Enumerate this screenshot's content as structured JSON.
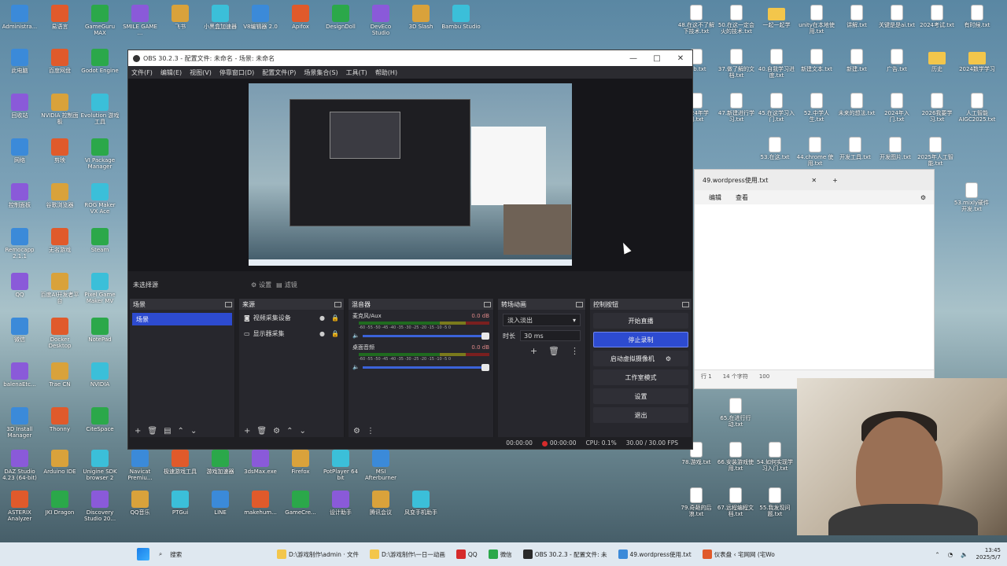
{
  "desktop": {
    "icons_left": [
      {
        "label": "Administra..."
      },
      {
        "label": "易语言"
      },
      {
        "label": "GameGuru MAX"
      },
      {
        "label": "SMILE GAME ..."
      },
      {
        "label": "飞书"
      },
      {
        "label": "小黑盒加速器"
      },
      {
        "label": "V8编辑器 2.0"
      },
      {
        "label": "Apifox"
      },
      {
        "label": "DesignDoll"
      },
      {
        "label": "DevEco Studio"
      },
      {
        "label": "3D Slash"
      },
      {
        "label": "Bambu Studio"
      },
      {
        "label": "此电脑"
      },
      {
        "label": "百度网盘"
      },
      {
        "label": "Godot Engine"
      },
      {
        "label": "回收站"
      },
      {
        "label": "NVIDIA 控制面板"
      },
      {
        "label": "Evolution 游戏工具"
      },
      {
        "label": "网络"
      },
      {
        "label": "剪映"
      },
      {
        "label": "VI Package Manager"
      },
      {
        "label": "控制面板"
      },
      {
        "label": "谷歌浏览器"
      },
      {
        "label": "ROG Maker VX Ace"
      },
      {
        "label": "Remocapp 2.1.1"
      },
      {
        "label": "无名游戏"
      },
      {
        "label": "Steam"
      },
      {
        "label": "QQ"
      },
      {
        "label": "百度AI开发者平台"
      },
      {
        "label": "Pixel Game Maker MV"
      },
      {
        "label": "微信"
      },
      {
        "label": "Docker Desktop"
      },
      {
        "label": "NotePad"
      },
      {
        "label": "balenaEtc..."
      },
      {
        "label": "Trae CN"
      },
      {
        "label": "NVIDIA"
      },
      {
        "label": "3D Install Manager"
      },
      {
        "label": "Thonny"
      },
      {
        "label": "CiteSpace"
      },
      {
        "label": "DAZ Studio 4.23 (64-bit)"
      },
      {
        "label": "Arduino IDE"
      },
      {
        "label": "Unigine SDK browser 2"
      },
      {
        "label": "Navicat Premiu..."
      },
      {
        "label": "极速游戏工具"
      },
      {
        "label": "游戏加速器"
      },
      {
        "label": "3dsMax.exe"
      },
      {
        "label": "Firefox"
      },
      {
        "label": "PotPlayer 64 bit"
      },
      {
        "label": "MSI Afterburner"
      },
      {
        "label": "ASTERIX Analyzer"
      },
      {
        "label": "JKI Dragon"
      },
      {
        "label": "Discovery Studio 20..."
      },
      {
        "label": "QQ音乐"
      },
      {
        "label": "PTGui"
      },
      {
        "label": "LINE"
      },
      {
        "label": "makehum..."
      },
      {
        "label": "GameCre..."
      },
      {
        "label": "设计助手"
      },
      {
        "label": "腾讯会议"
      },
      {
        "label": "风变手机助手"
      }
    ],
    "icons_right": [
      {
        "label": "48.在这不了解下技术.txt"
      },
      {
        "label": "50.在这一定会火的技术.txt"
      },
      {
        "label": "一起一起学"
      },
      {
        "label": "unity在本地使用.txt"
      },
      {
        "label": "讲解.txt"
      },
      {
        "label": "关键是是ai.txt"
      },
      {
        "label": "2024考试.txt"
      },
      {
        "label": "有时候.txt"
      },
      {
        "label": "28b.txt"
      },
      {
        "label": "37.做了解的文档.txt"
      },
      {
        "label": "40.自我学习进度.txt"
      },
      {
        "label": "新建文本.txt"
      },
      {
        "label": "新建.txt"
      },
      {
        "label": "广告.txt"
      },
      {
        "label": "历史"
      },
      {
        "label": "2024数学学习"
      },
      {
        "label": "2024年学习.txt"
      },
      {
        "label": "47.新建进行学习.txt"
      },
      {
        "label": "45.在这学习入门.txt"
      },
      {
        "label": "52.中学人生.txt"
      },
      {
        "label": "未来的想法.txt"
      },
      {
        "label": "2024年入门.txt"
      },
      {
        "label": "2026我要学习.txt"
      },
      {
        "label": "人工智能 AIGC2025.txt"
      },
      {
        "label": "53.在这.txt"
      },
      {
        "label": "44.chrome 使用.txt"
      },
      {
        "label": "开发工具.txt"
      },
      {
        "label": "开发图片.txt"
      },
      {
        "label": "2025年人工智能.txt"
      },
      {
        "label": "53.mixly硬件开发.txt"
      },
      {
        "label": "65.在进行行动.txt"
      },
      {
        "label": "78.游戏.txt"
      },
      {
        "label": "66.安装游戏使用.txt"
      },
      {
        "label": "54.如何实现学习入门.txt"
      },
      {
        "label": "79.奇葩的后浪.txt"
      },
      {
        "label": "67.远程编程文档.txt"
      },
      {
        "label": "55.我发现问题.txt"
      }
    ]
  },
  "obs": {
    "title": "OBS 30.2.3 - 配置文件: 未命名 - 场景: 未命名",
    "window_controls": [
      "—",
      "□",
      "✕"
    ],
    "menu": [
      "文件(F)",
      "编辑(E)",
      "视图(V)",
      "停靠窗口(D)",
      "配置文件(P)",
      "场景集合(S)",
      "工具(T)",
      "帮助(H)"
    ],
    "scenebar": {
      "no_source": "未选择源",
      "settings": "设置",
      "filters": "滤镜"
    },
    "docks": {
      "scenes": {
        "title": "场景",
        "items": [
          "场景"
        ]
      },
      "sources": {
        "title": "来源",
        "items": [
          "视频采集设备",
          "显示器采集"
        ]
      },
      "mixer": {
        "title": "混音器",
        "channels": [
          {
            "name": "麦克风/Aux",
            "db": "0.0 dB"
          },
          {
            "name": "桌面音频",
            "db": "0.0 dB"
          }
        ],
        "ticks": "-60 -55 -50 -45 -40 -35 -30 -25 -20 -15 -10 -5 0"
      },
      "transitions": {
        "title": "转场动画",
        "selected": "淡入淡出",
        "duration_label": "时长",
        "duration": "30 ms"
      },
      "controls": {
        "title": "控制按钮",
        "buttons": [
          "开始直播",
          "停止录制",
          "启动虚拟摄像机",
          "工作室模式",
          "设置",
          "退出"
        ]
      }
    },
    "status": {
      "stream_time": "00:00:00",
      "rec_time": "00:00:00",
      "cpu": "CPU: 0.1%",
      "fps": "30.00 / 30.00 FPS"
    }
  },
  "notepad": {
    "tab_title": "49.wordpress使用.txt",
    "menu": [
      "编辑",
      "查看"
    ],
    "status_line": "行 1",
    "status_chars": "14 个字符",
    "status_zoom": "100"
  },
  "taskbar": {
    "search": "搜索",
    "items": [
      {
        "label": "D:\\游戏制作\\admin · 文件",
        "color": "#f3c64b"
      },
      {
        "label": "D:\\游戏制作\\一日一动画",
        "color": "#f3c64b"
      },
      {
        "label": "QQ",
        "color": "#d62b2b"
      },
      {
        "label": "微信",
        "color": "#2ba84a"
      },
      {
        "label": "OBS 30.2.3 - 配置文件: 未",
        "color": "#2a2a2a"
      },
      {
        "label": "49.wordpress使用.txt",
        "color": "#3b8ad9"
      },
      {
        "label": "仪表盘 ‹ 宅网网 (宅Wo",
        "color": "#e05a2b"
      }
    ],
    "time": "13:45",
    "date": "2025/5/7"
  }
}
